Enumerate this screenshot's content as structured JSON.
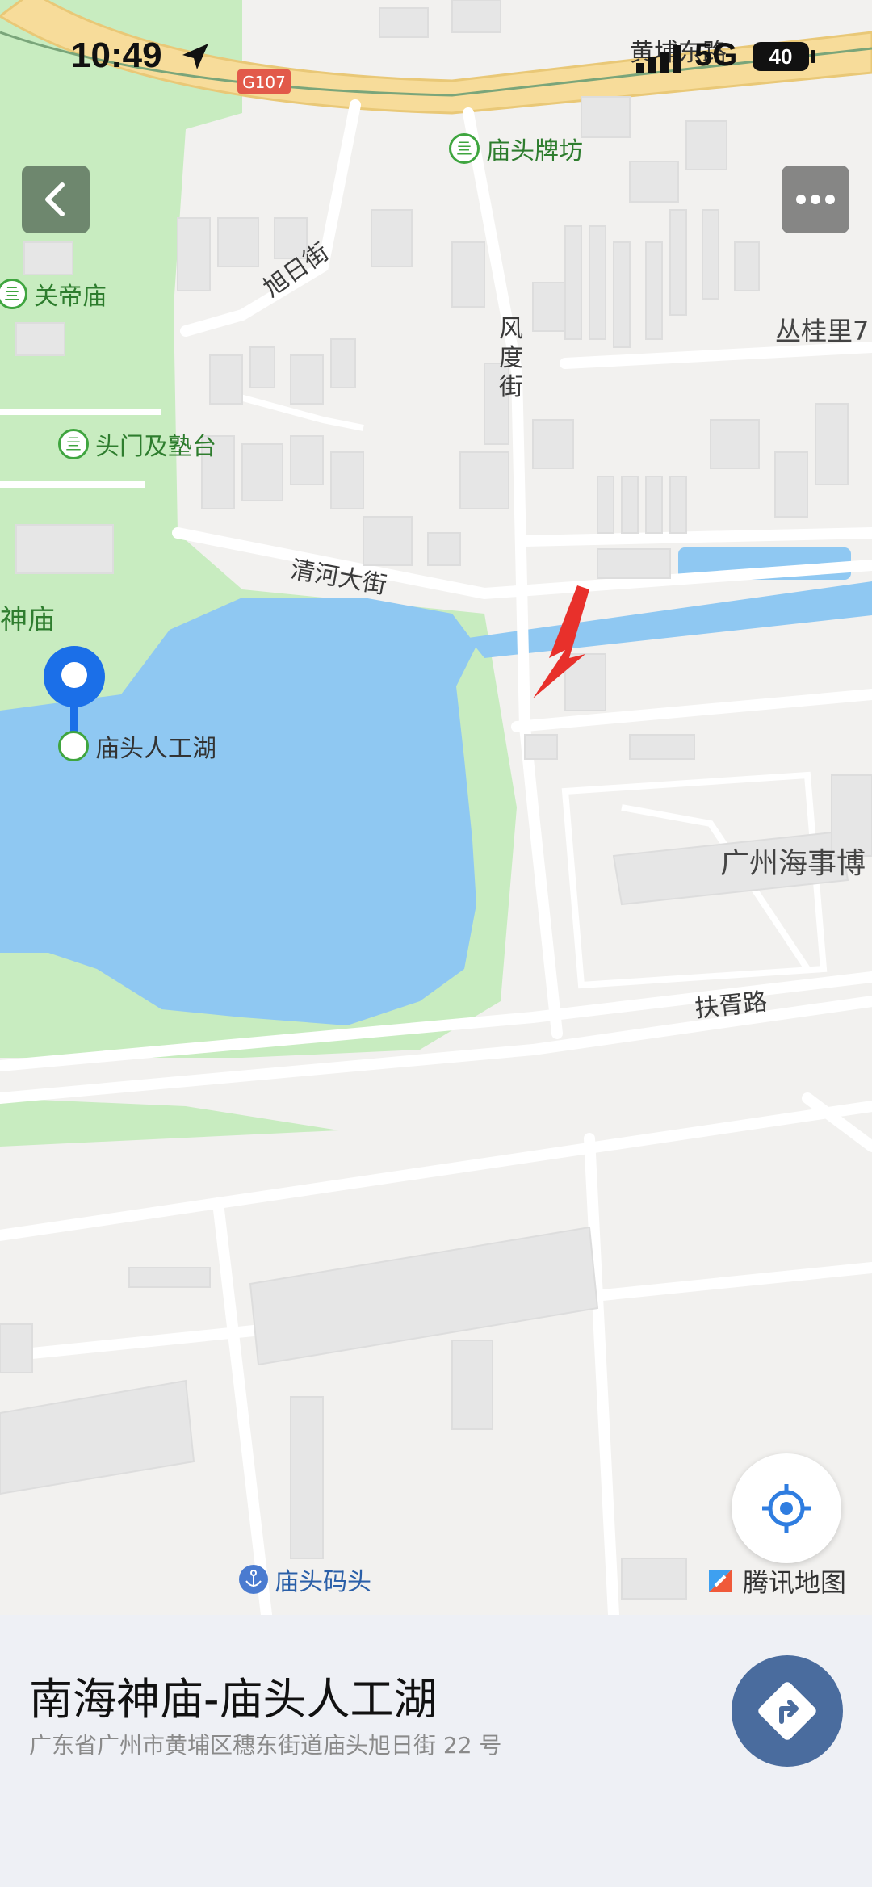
{
  "status_bar": {
    "time": "10:49",
    "network": "5G",
    "battery": "40"
  },
  "map": {
    "labels": {
      "road_top_right": "黄埔东路",
      "highway_badge": "G107",
      "xuri_street": "旭日街",
      "fengdu_street": "风度街",
      "qinghe_street": "清河大街",
      "fuxu_road": "扶胥路",
      "congguili": "丛桂里7",
      "museum": "广州海事博",
      "shenmiao": "神庙"
    },
    "pois": {
      "paifang": "庙头牌坊",
      "guandimiao": "关帝庙",
      "toumen": "头门及塾台",
      "lake": "庙头人工湖",
      "wharf": "庙头码头"
    },
    "brand": "腾讯地图",
    "colors": {
      "water": "#8fc8f2",
      "park": "#c8ecc0",
      "land": "#f2f1ef",
      "pin": "#1b6fe8",
      "arrow": "#e8302b"
    }
  },
  "sheet": {
    "title": "南海神庙-庙头人工湖",
    "address": "广东省广州市黄埔区穗东街道庙头旭日街 22 号"
  },
  "icons": {
    "back": "chevron-left-icon",
    "more": "more-dots-icon",
    "locate": "locate-icon",
    "route": "route-icon",
    "pin": "map-pin-icon"
  }
}
